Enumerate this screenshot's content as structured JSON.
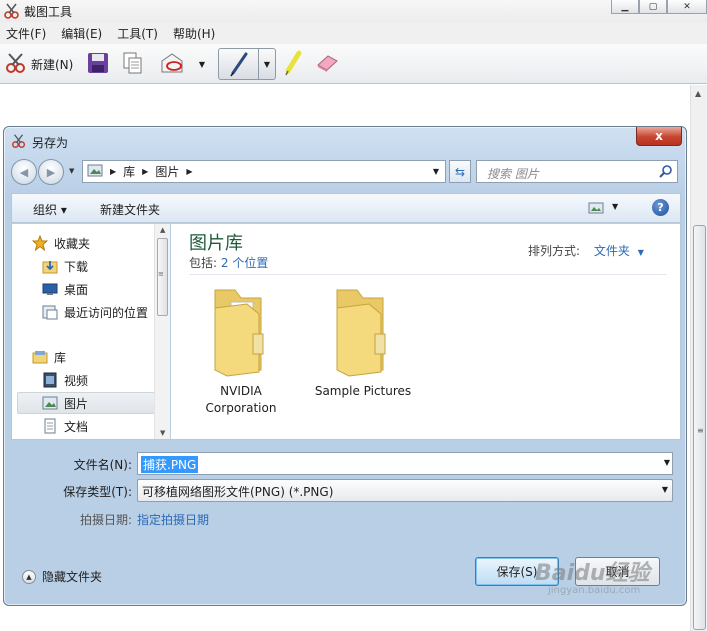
{
  "app": {
    "title": "截图工具",
    "menu": [
      "文件(F)",
      "编辑(E)",
      "工具(T)",
      "帮助(H)"
    ],
    "toolbar": {
      "new_label": "新建(N)"
    }
  },
  "dialog": {
    "title": "另存为",
    "close_glyph": "x",
    "breadcrumb": [
      "库",
      "图片"
    ],
    "search_placeholder": "搜索 图片",
    "commands": {
      "organize": "组织 ▾",
      "new_folder": "新建文件夹"
    },
    "nav_items": [
      {
        "label": "收藏夹",
        "icon": "star-icon"
      },
      {
        "label": "下载",
        "icon": "download-folder-icon"
      },
      {
        "label": "桌面",
        "icon": "desktop-icon"
      },
      {
        "label": "最近访问的位置",
        "icon": "recent-places-icon"
      },
      {
        "label": "库",
        "icon": "library-icon"
      },
      {
        "label": "视频",
        "icon": "video-icon"
      },
      {
        "label": "图片",
        "icon": "pictures-icon",
        "selected": true
      },
      {
        "label": "文档",
        "icon": "documents-icon"
      }
    ],
    "library": {
      "title": "图片库",
      "includes_label": "包括:",
      "includes_link": "2 个位置",
      "arrange_label": "排列方式:",
      "arrange_value": "文件夹",
      "folders": [
        {
          "line1": "NVIDIA",
          "line2": "Corporation"
        },
        {
          "line1": "Sample Pictures",
          "line2": ""
        }
      ]
    },
    "filename_label": "文件名(N):",
    "filename_value": "捕获.PNG",
    "filetype_label": "保存类型(T):",
    "filetype_value": "可移植网络图形文件(PNG) (*.PNG)",
    "date_label": "拍摄日期:",
    "date_link": "指定拍摄日期",
    "hide_folders": "隐藏文件夹",
    "save_button": "保存(S)",
    "cancel_button": "取消"
  },
  "watermark": {
    "text": "Baidu经验",
    "sub": "jingyan.baidu.com"
  },
  "colors": {
    "link": "#2b6bb5",
    "library_title": "#1e5b3b",
    "selection": "#3399ff",
    "close_red": "#c7452f"
  }
}
